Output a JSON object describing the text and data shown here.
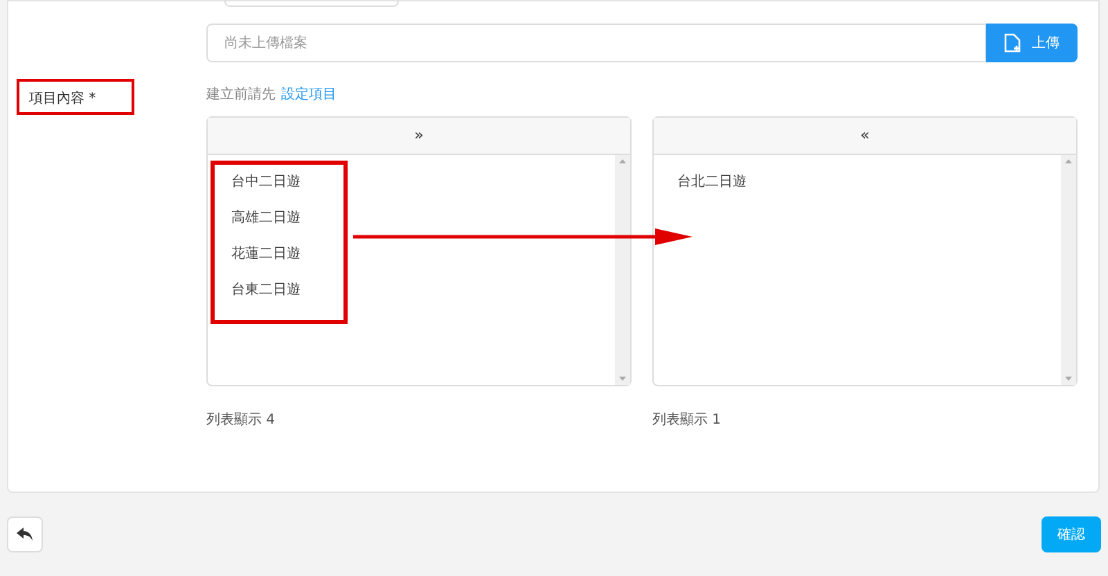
{
  "upload": {
    "placeholder": "尚未上傳檔案",
    "button": "上傳"
  },
  "field": {
    "label": "項目內容 *",
    "hint": "建立前請先",
    "hint_link": "設定項目"
  },
  "lists": [
    {
      "header": "»",
      "items": [
        "台中二日遊",
        "高雄二日遊",
        "花蓮二日遊",
        "台東二日遊"
      ],
      "count": "列表顯示 4"
    },
    {
      "header": "«",
      "items": [
        "台北二日遊"
      ],
      "count": "列表顯示 1"
    }
  ],
  "confirm": "確認"
}
